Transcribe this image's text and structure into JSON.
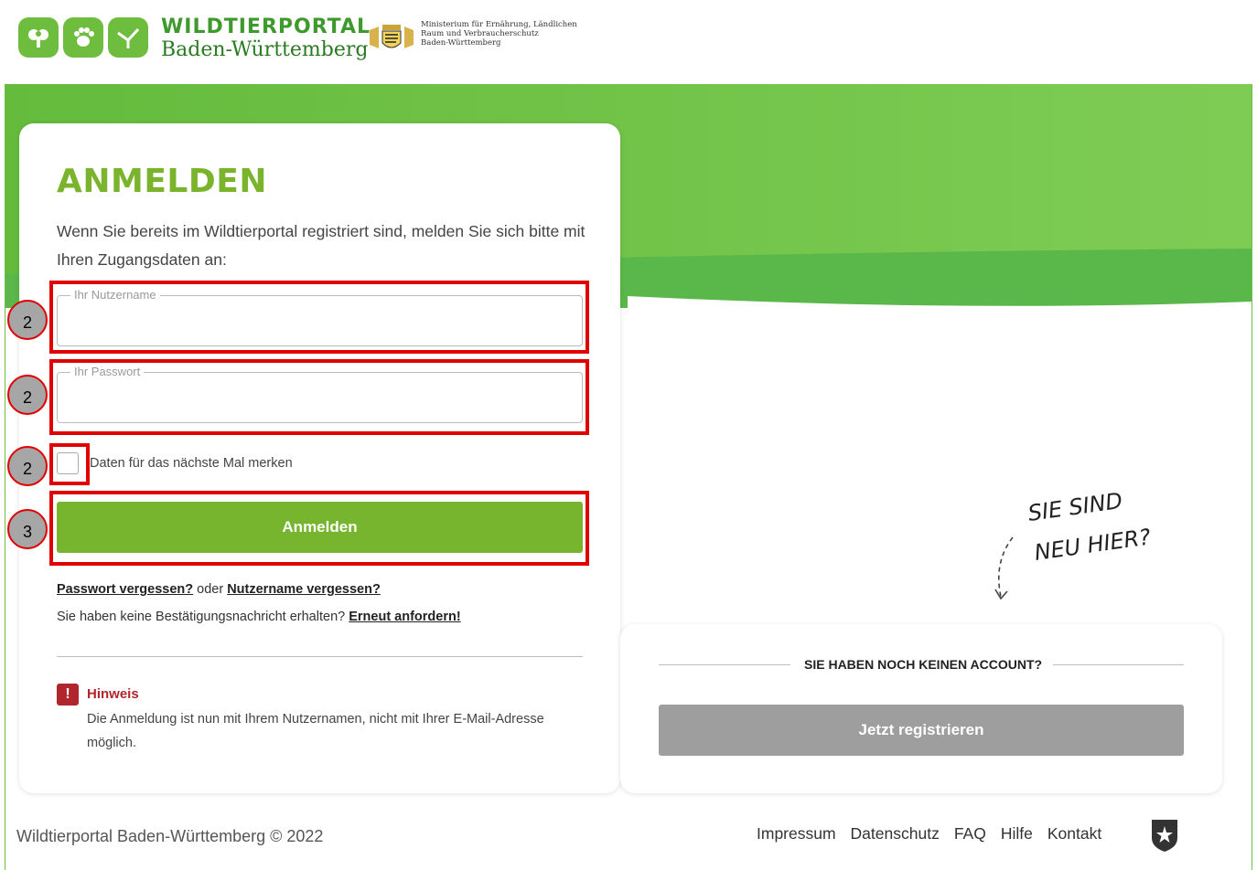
{
  "header": {
    "brand_top": "WILDTIERPORTAL",
    "brand_bottom": "Baden-Württemberg",
    "ministry_line1": "Ministerium für Ernährung, Ländlichen",
    "ministry_line2": "Raum und Verbraucherschutz",
    "ministry_line3": "Baden-Württemberg"
  },
  "login": {
    "title": "ANMELDEN",
    "intro": "Wenn Sie bereits im Wildtierportal registriert sind, melden Sie sich bitte mit Ihren Zugangsdaten an:",
    "username_legend": "Ihr Nutzername",
    "username_value": "",
    "password_legend": "Ihr Passwort",
    "password_value": "",
    "remember_label": "Daten für das nächste Mal merken",
    "remember_checked": false,
    "submit_label": "Anmelden",
    "forgot_password": "Passwort vergessen?",
    "or_text": "oder",
    "forgot_username": "Nutzername vergessen?",
    "no_confirmation_text": "Sie haben keine Bestätigungsnachricht erhalten?",
    "request_again": "Erneut anfordern!",
    "hint_icon": "!",
    "hint_title": "Hinweis",
    "hint_text": "Die Anmeldung ist nun mit Ihrem Nutzernamen, nicht mit Ihrer E-Mail-Adresse möglich."
  },
  "annotations": {
    "badge_username": "2",
    "badge_password": "2",
    "badge_checkbox": "2",
    "badge_submit": "3",
    "highlight_color": "#e00000"
  },
  "register": {
    "heading": "SIE HABEN NOCH KEINEN ACCOUNT?",
    "button_label": "Jetzt registrieren",
    "scribble_line1": "SIE SIND",
    "scribble_line2": "NEU HIER?"
  },
  "footer": {
    "copyright": "Wildtierportal Baden-Württemberg © 2022",
    "links": [
      "Impressum",
      "Datenschutz",
      "FAQ",
      "Hilfe",
      "Kontakt"
    ]
  },
  "colors": {
    "brand_green": "#78b52e",
    "band_green": "#6cc24a",
    "hint_red": "#b1252d",
    "register_gray": "#9e9e9e"
  }
}
